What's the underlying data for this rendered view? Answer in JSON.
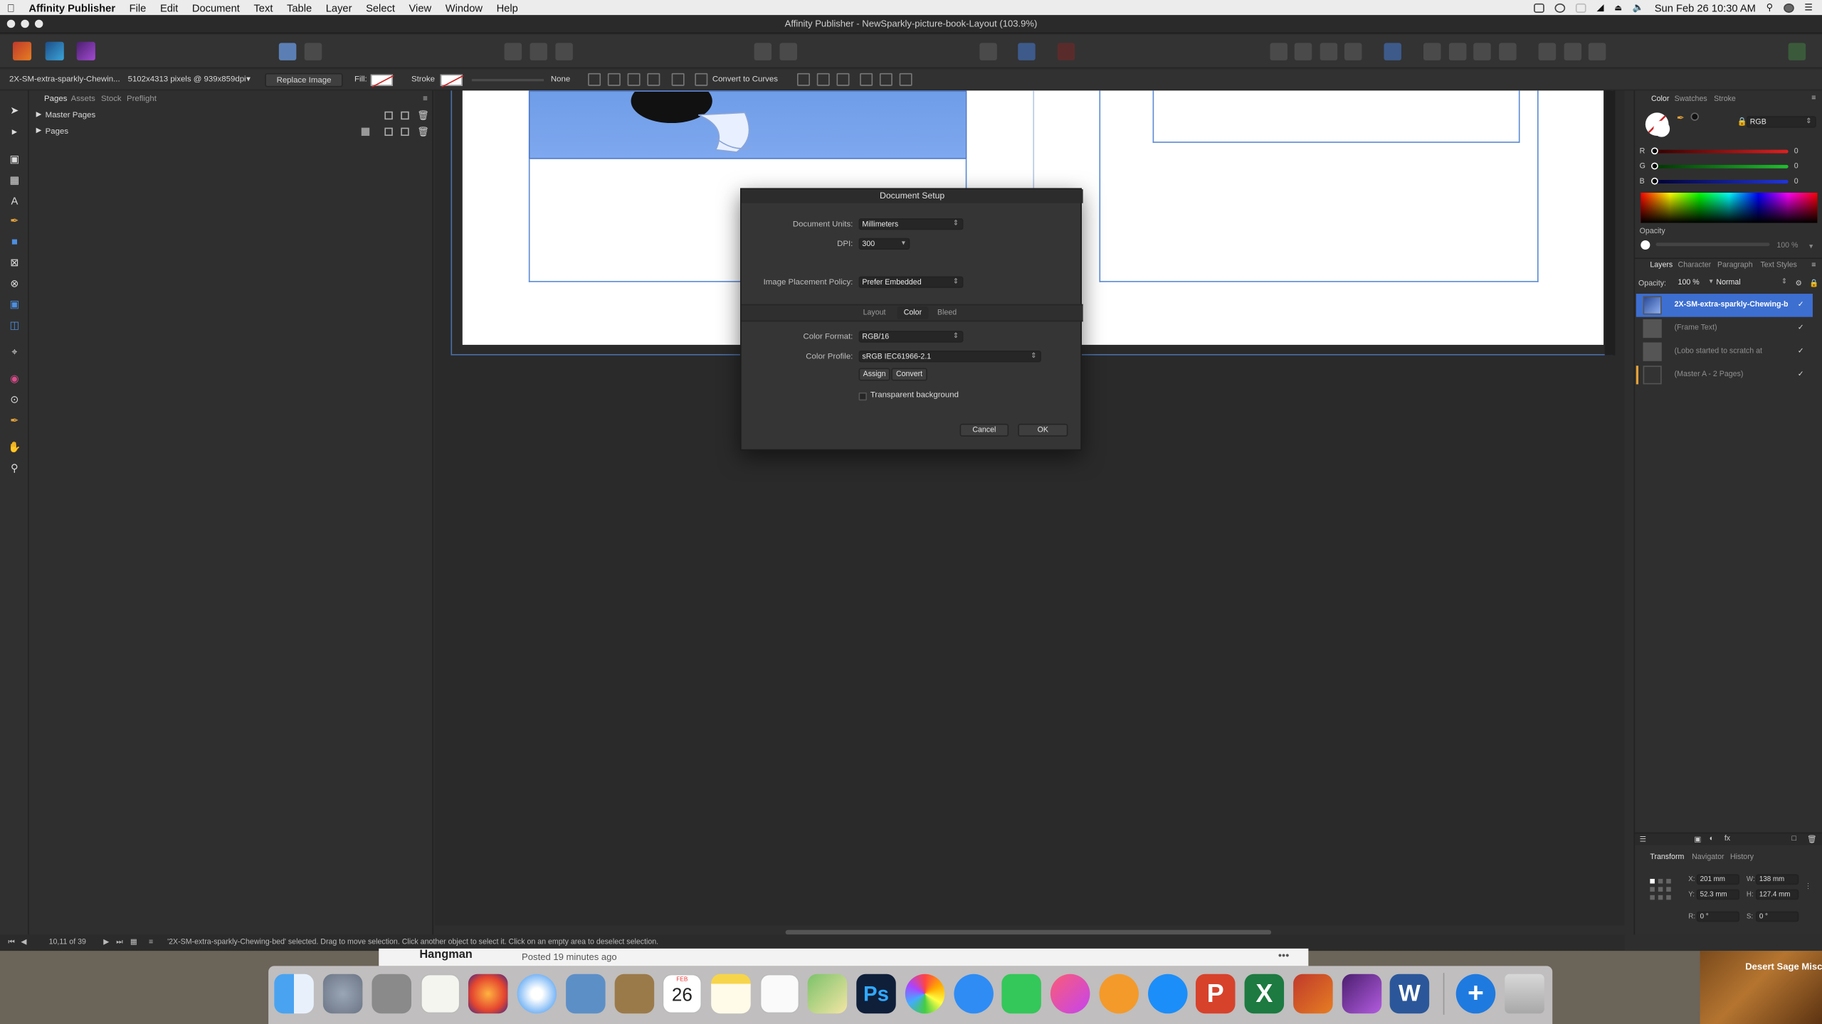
{
  "menubar": {
    "app_name": "Affinity Publisher",
    "items": [
      "File",
      "Edit",
      "Document",
      "Text",
      "Table",
      "Layer",
      "Select",
      "View",
      "Window",
      "Help"
    ],
    "clock": "Sun Feb 26  10:30 AM"
  },
  "window": {
    "title": "Affinity Publisher - NewSparkly-picture-book-Layout (103.9%)"
  },
  "context_toolbar": {
    "layer_name": "2X-SM-extra-sparkly-Chewin...",
    "image_info": "5102x4313 pixels @ 939x859dpi",
    "replace_image": "Replace Image",
    "fill_label": "Fill:",
    "stroke_label": "Stroke",
    "stroke_value": "None",
    "convert_to_curves": "Convert to Curves"
  },
  "pages_panel": {
    "tabs": [
      "Pages",
      "Assets",
      "Stock",
      "Preflight"
    ],
    "rows": [
      "Master Pages",
      "Pages"
    ]
  },
  "dialog": {
    "title": "Document Setup",
    "document_units_label": "Document Units:",
    "document_units_value": "Millimeters",
    "dpi_label": "DPI:",
    "dpi_value": "300",
    "image_placement_label": "Image Placement Policy:",
    "image_placement_value": "Prefer Embedded",
    "tabs": [
      "Layout",
      "Color",
      "Bleed"
    ],
    "active_tab": "Color",
    "color_format_label": "Color Format:",
    "color_format_value": "RGB/16",
    "color_profile_label": "Color Profile:",
    "color_profile_value": "sRGB IEC61966-2.1",
    "assign_label": "Assign",
    "convert_label": "Convert",
    "transparent_bg_label": "Transparent background",
    "cancel_label": "Cancel",
    "ok_label": "OK"
  },
  "color_panel": {
    "tabs": [
      "Color",
      "Swatches",
      "Stroke"
    ],
    "mode": "RGB",
    "channels": [
      {
        "label": "R",
        "value": "0",
        "color": "#d42020"
      },
      {
        "label": "G",
        "value": "0",
        "color": "#1fa02a"
      },
      {
        "label": "B",
        "value": "0",
        "color": "#2035c8"
      }
    ],
    "opacity_label": "Opacity",
    "opacity_value": "100 %"
  },
  "layers_panel": {
    "tabs": [
      "Layers",
      "Character",
      "Paragraph",
      "Text Styles"
    ],
    "opacity_label": "Opacity:",
    "opacity_value": "100 %",
    "blend_mode": "Normal",
    "layers": [
      {
        "name": "2X-SM-extra-sparkly-Chewing-b",
        "selected": true
      },
      {
        "name": "(Frame Text)",
        "selected": false
      },
      {
        "name": "(Lobo started to scratch at",
        "selected": false
      },
      {
        "name": "(Master A - 2 Pages)",
        "selected": false
      }
    ]
  },
  "transform_panel": {
    "tabs": [
      "Transform",
      "Navigator",
      "History"
    ],
    "x_label": "X:",
    "x_value": "201 mm",
    "y_label": "Y:",
    "y_value": "52.3 mm",
    "w_label": "W:",
    "w_value": "138 mm",
    "h_label": "H:",
    "h_value": "127.4 mm",
    "r_label": "R:",
    "r_value": "0 °",
    "s_label": "S:",
    "s_value": "0 °"
  },
  "status_bar": {
    "page_indicator": "10,11 of 39",
    "message": "'2X-SM-extra-sparkly-Chewing-bed' selected. Drag to move selection. Click another object to select it. Click on an empty area to deselect selection."
  },
  "background": {
    "forum_title": "Hangman",
    "forum_posted": "Posted 19 minutes ago",
    "desktop_label": "Desert Sage Misc."
  },
  "dock": {
    "calendar_month": "FEB",
    "calendar_day": "26"
  },
  "accent_color": "#3d6fd1"
}
